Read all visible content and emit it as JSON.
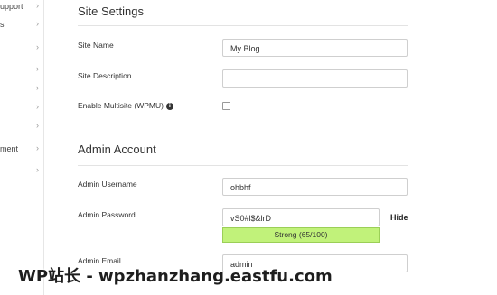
{
  "sidebar": {
    "items": [
      {
        "label": "upport"
      },
      {
        "label": "s"
      },
      {
        "label": ""
      },
      {
        "label": ""
      },
      {
        "label": ""
      },
      {
        "label": ""
      },
      {
        "label": ""
      },
      {
        "label": ""
      },
      {
        "label": "ment"
      },
      {
        "label": ""
      }
    ],
    "chevron": "›"
  },
  "site_settings": {
    "title": "Site Settings",
    "site_name_label": "Site Name",
    "site_name_value": "My Blog",
    "site_description_label": "Site Description",
    "site_description_value": "",
    "multisite_label": "Enable Multisite (WPMU)",
    "multisite_info_icon": "info-icon",
    "multisite_checked": false
  },
  "admin_account": {
    "title": "Admin Account",
    "username_label": "Admin Username",
    "username_value": "ohbhf",
    "password_label": "Admin Password",
    "password_value": "vS0#l$&lrD",
    "hide_label": "Hide",
    "strength_label": "Strong (65/100)",
    "strength_color": "#c1f27a",
    "email_label": "Admin Email",
    "email_value": "admin"
  },
  "watermark": {
    "text": "WP站长 - wpzhanzhang.eastfu.com"
  }
}
